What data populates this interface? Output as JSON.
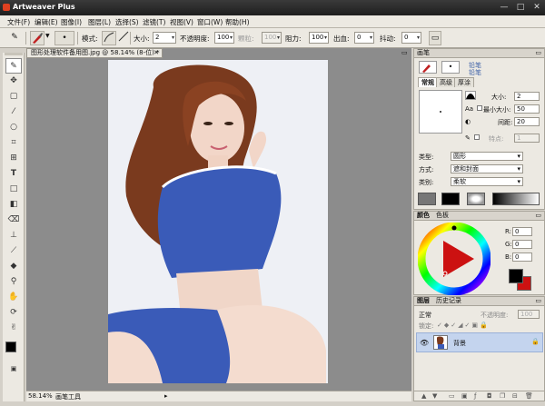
{
  "window": {
    "title": "Artweaver Plus"
  },
  "menu": [
    "文件(F)",
    "编辑(E)",
    "图像(I)",
    "图层(L)",
    "选择(S)",
    "滤镜(T)",
    "视图(V)",
    "窗口(W)",
    "帮助(H)"
  ],
  "toolbar": {
    "mode_label": "模式:",
    "size_label": "大小:",
    "size_value": "2",
    "opacity_label": "不透明度:",
    "opacity_value": "100",
    "grain_label": "颗粒:",
    "grain_value": "100",
    "resist_label": "阻力:",
    "resist_value": "100",
    "bleed_label": "出血:",
    "bleed_value": "0",
    "jitter_label": "抖动:",
    "jitter_value": "0"
  },
  "document": {
    "tab_title": "图形处理软件备用图.jpg @ 58.14% (8-位) *",
    "zoom_status": "58.14%",
    "tool_status": "画笔工具"
  },
  "brush_panel": {
    "title": "画笔",
    "preset_line1": "铅笔",
    "preset_line2": "铅笔",
    "tabs": [
      "常规",
      "高级",
      "厚涂"
    ],
    "size_label": "大小:",
    "size_value": "2",
    "min_size_label": "最小大小:",
    "min_size_value": "50",
    "spacing_label": "间距:",
    "spacing_value": "20",
    "feature_label": "特点:",
    "feature_value": "1",
    "type_label": "类型:",
    "type_value": "圆形",
    "method_label": "方式:",
    "method_value": "遮和封面",
    "category_label": "类别:",
    "category_value": "柔软"
  },
  "color_panel": {
    "tabs": [
      "颜色",
      "色板"
    ],
    "r_label": "R:",
    "r_value": "0",
    "g_label": "G:",
    "g_value": "0",
    "b_label": "B:",
    "b_value": "0",
    "fg_color": "#000000",
    "bg_color": "#cc1111"
  },
  "layers_panel": {
    "tabs": [
      "图层",
      "历史记录"
    ],
    "blend_mode": "正常",
    "opacity_label": "不透明度:",
    "opacity_value": "100",
    "lock_label": "锁定:",
    "layer_name": "背景"
  }
}
